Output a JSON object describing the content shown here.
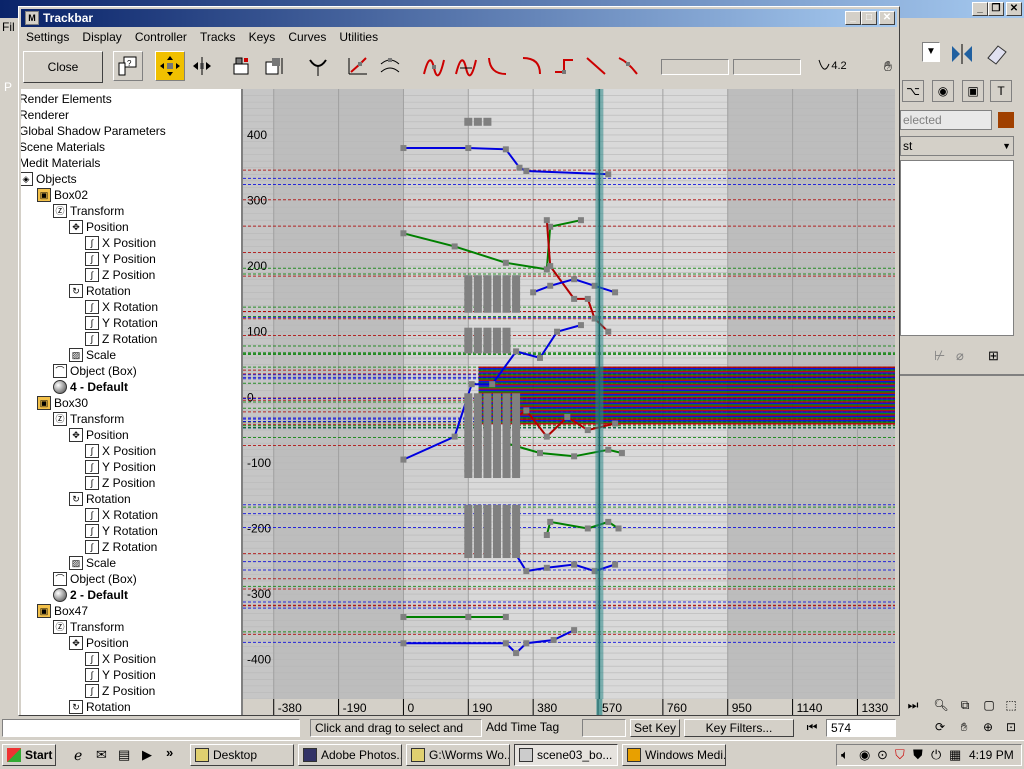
{
  "background_app": {
    "left_menu_fragment": "Fil",
    "left_edge_fragment": "P",
    "right_panel": {
      "selected_field": "elected",
      "list_field": "st"
    }
  },
  "trackbar": {
    "title": "Trackbar",
    "menus": [
      "Settings",
      "Display",
      "Controller",
      "Tracks",
      "Keys",
      "Curves",
      "Utilities"
    ],
    "close_label": "Close",
    "value_label": "4.2"
  },
  "tree": {
    "items": [
      {
        "label": "Render Elements",
        "indent": 0,
        "bold": false,
        "icon": "none"
      },
      {
        "label": "Renderer",
        "indent": 0,
        "bold": false,
        "icon": "none"
      },
      {
        "label": "Global Shadow Parameters",
        "indent": 0,
        "bold": false,
        "icon": "none"
      },
      {
        "label": "Scene Materials",
        "indent": 0,
        "bold": false,
        "icon": "none"
      },
      {
        "label": "Medit Materials",
        "indent": 0,
        "bold": false,
        "icon": "none"
      },
      {
        "label": "Objects",
        "indent": 0,
        "bold": false,
        "icon": "objects"
      },
      {
        "label": "Box02",
        "indent": 1,
        "bold": false,
        "icon": "cube"
      },
      {
        "label": "Transform",
        "indent": 2,
        "bold": false,
        "icon": "transform"
      },
      {
        "label": "Position",
        "indent": 3,
        "bold": false,
        "icon": "position"
      },
      {
        "label": "X Position",
        "indent": 4,
        "bold": false,
        "icon": "curve"
      },
      {
        "label": "Y Position",
        "indent": 4,
        "bold": false,
        "icon": "curve"
      },
      {
        "label": "Z Position",
        "indent": 4,
        "bold": false,
        "icon": "curve"
      },
      {
        "label": "Rotation",
        "indent": 3,
        "bold": false,
        "icon": "rotation"
      },
      {
        "label": "X Rotation",
        "indent": 4,
        "bold": false,
        "icon": "curve"
      },
      {
        "label": "Y Rotation",
        "indent": 4,
        "bold": false,
        "icon": "curve"
      },
      {
        "label": "Z Rotation",
        "indent": 4,
        "bold": false,
        "icon": "curve"
      },
      {
        "label": "Scale",
        "indent": 3,
        "bold": false,
        "icon": "scale"
      },
      {
        "label": "Object (Box)",
        "indent": 2,
        "bold": false,
        "icon": "object"
      },
      {
        "label": "4 - Default",
        "indent": 2,
        "bold": true,
        "icon": "material"
      },
      {
        "label": "Box30",
        "indent": 1,
        "bold": false,
        "icon": "cube"
      },
      {
        "label": "Transform",
        "indent": 2,
        "bold": false,
        "icon": "transform"
      },
      {
        "label": "Position",
        "indent": 3,
        "bold": false,
        "icon": "position"
      },
      {
        "label": "X Position",
        "indent": 4,
        "bold": false,
        "icon": "curve"
      },
      {
        "label": "Y Position",
        "indent": 4,
        "bold": false,
        "icon": "curve"
      },
      {
        "label": "Z Position",
        "indent": 4,
        "bold": false,
        "icon": "curve"
      },
      {
        "label": "Rotation",
        "indent": 3,
        "bold": false,
        "icon": "rotation"
      },
      {
        "label": "X Rotation",
        "indent": 4,
        "bold": false,
        "icon": "curve"
      },
      {
        "label": "Y Rotation",
        "indent": 4,
        "bold": false,
        "icon": "curve"
      },
      {
        "label": "Z Rotation",
        "indent": 4,
        "bold": false,
        "icon": "curve"
      },
      {
        "label": "Scale",
        "indent": 3,
        "bold": false,
        "icon": "scale"
      },
      {
        "label": "Object (Box)",
        "indent": 2,
        "bold": false,
        "icon": "object"
      },
      {
        "label": "2 - Default",
        "indent": 2,
        "bold": true,
        "icon": "material"
      },
      {
        "label": "Box47",
        "indent": 1,
        "bold": false,
        "icon": "cube"
      },
      {
        "label": "Transform",
        "indent": 2,
        "bold": false,
        "icon": "transform"
      },
      {
        "label": "Position",
        "indent": 3,
        "bold": false,
        "icon": "position"
      },
      {
        "label": "X Position",
        "indent": 4,
        "bold": false,
        "icon": "curve"
      },
      {
        "label": "Y Position",
        "indent": 4,
        "bold": false,
        "icon": "curve"
      },
      {
        "label": "Z Position",
        "indent": 4,
        "bold": false,
        "icon": "curve"
      },
      {
        "label": "Rotation",
        "indent": 3,
        "bold": false,
        "icon": "rotation"
      }
    ]
  },
  "curve_graph": {
    "y_ticks": [
      "400",
      "300",
      "200",
      "100",
      "0",
      "-100",
      "-200",
      "-300",
      "-400"
    ],
    "x_ticks": [
      "-380",
      "-190",
      "0",
      "190",
      "380",
      "570",
      "760",
      "950",
      "1140",
      "1330"
    ],
    "current_frame_marker": 574,
    "colors": {
      "x_curve": "#b00000",
      "y_curve": "#008000",
      "z_curve": "#0000e0",
      "key": "#808080",
      "time_slider": "#2e8b8b"
    }
  },
  "status_bar": {
    "prompt": "Click and drag to select and move",
    "add_time_tag": "Add Time Tag",
    "set_key": "Set Key",
    "key_filters": "Key Filters...",
    "frame": "574"
  },
  "taskbar": {
    "start": "Start",
    "tasks": [
      "Desktop",
      "Adobe Photos...",
      "G:\\Worms Wo...",
      "scene03_bo...",
      "Windows Medi..."
    ],
    "active_task": 3,
    "clock": "4:19 PM"
  }
}
